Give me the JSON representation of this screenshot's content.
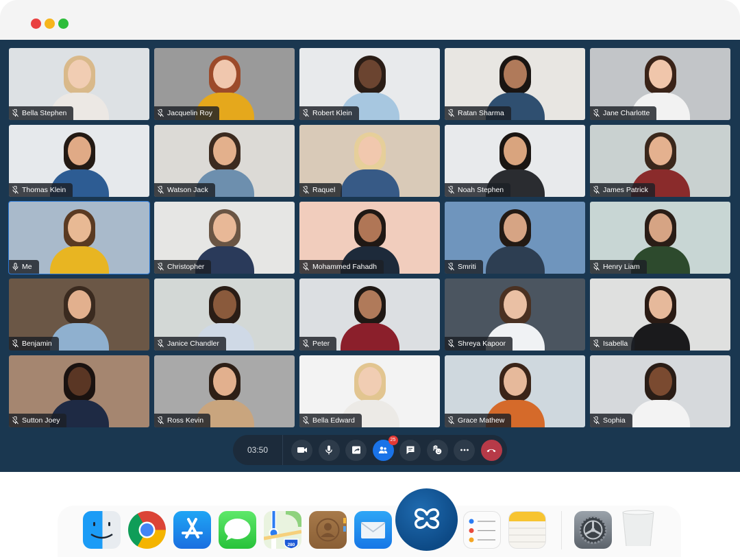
{
  "window": {
    "controls": [
      "close",
      "minimize",
      "maximize"
    ]
  },
  "call": {
    "active_participant": "Me",
    "participants": [
      {
        "name": "Bella Stephen",
        "muted": true,
        "bg": "#dde1e4",
        "skin": "#f1cdb3",
        "hair": "#d9b98a",
        "shirt": "#ece8e4"
      },
      {
        "name": "Jacquelin Roy",
        "muted": true,
        "bg": "#9a9a9a",
        "skin": "#f0c7ae",
        "hair": "#9c4a2a",
        "shirt": "#e5a81c"
      },
      {
        "name": "Robert Klein",
        "muted": true,
        "bg": "#e8eaec",
        "skin": "#6b4430",
        "hair": "#2a1d16",
        "shirt": "#a7c7e0"
      },
      {
        "name": "Ratan Sharma",
        "muted": true,
        "bg": "#e8e6e2",
        "skin": "#b07a5a",
        "hair": "#1a1512",
        "shirt": "#2f4f70"
      },
      {
        "name": "Jane Charlotte",
        "muted": true,
        "bg": "#c2c5c8",
        "skin": "#f0c6ab",
        "hair": "#3a2318",
        "shirt": "#f2f2f2"
      },
      {
        "name": "Thomas Klein",
        "muted": true,
        "bg": "#e6e9ec",
        "skin": "#e0aa86",
        "hair": "#231a14",
        "shirt": "#2d5c93"
      },
      {
        "name": "Watson Jack",
        "muted": true,
        "bg": "#dcdad6",
        "skin": "#e3b08c",
        "hair": "#3b2a1f",
        "shirt": "#6d8fae"
      },
      {
        "name": "Raquel",
        "muted": true,
        "bg": "#d9cab8",
        "skin": "#f1c8ae",
        "hair": "#e6cf9a",
        "shirt": "#375a86"
      },
      {
        "name": "Noah Stephen",
        "muted": true,
        "bg": "#e8eaec",
        "skin": "#d9a47e",
        "hair": "#1a1512",
        "shirt": "#2a2c30"
      },
      {
        "name": "James Patrick",
        "muted": true,
        "bg": "#c9d1d0",
        "skin": "#e4b18f",
        "hair": "#3a271b",
        "shirt": "#8a2b2b"
      },
      {
        "name": "Me",
        "muted": false,
        "bg": "#a9bacb",
        "skin": "#e8b994",
        "hair": "#5a3a22",
        "shirt": "#e8b522"
      },
      {
        "name": "Christopher",
        "muted": true,
        "bg": "#e6e6e4",
        "skin": "#e8b897",
        "hair": "#6a5544",
        "shirt": "#2a3a5a"
      },
      {
        "name": "Mohammed Fahadh",
        "muted": true,
        "bg": "#f1cdbd",
        "skin": "#b07656",
        "hair": "#1f1814",
        "shirt": "#1d2a3a"
      },
      {
        "name": "Smriti",
        "muted": true,
        "bg": "#6f95bd",
        "skin": "#d6a484",
        "hair": "#231a14",
        "shirt": "#2d3e52"
      },
      {
        "name": "Henry Liam",
        "muted": true,
        "bg": "#c8d6d4",
        "skin": "#d6a484",
        "hair": "#2a1d16",
        "shirt": "#2d4a2d"
      },
      {
        "name": "Benjamin",
        "muted": true,
        "bg": "#6b5746",
        "skin": "#e2b08e",
        "hair": "#3a2a1f",
        "shirt": "#8fb0cf"
      },
      {
        "name": "Janice Chandler",
        "muted": true,
        "bg": "#d3d8d6",
        "skin": "#8a5a3c",
        "hair": "#2a1d16",
        "shirt": "#cfd9e6"
      },
      {
        "name": "Peter",
        "muted": true,
        "bg": "#dcdfe2",
        "skin": "#b07a5a",
        "hair": "#1f1814",
        "shirt": "#8b1f2b"
      },
      {
        "name": "Shreya Kapoor",
        "muted": true,
        "bg": "#4b5560",
        "skin": "#eac0a4",
        "hair": "#4a3122",
        "shirt": "#f0f2f4"
      },
      {
        "name": "Isabella",
        "muted": true,
        "bg": "#dfe0df",
        "skin": "#e6b99b",
        "hair": "#2a1b14",
        "shirt": "#1a1a1c"
      },
      {
        "name": "Sutton Joey",
        "muted": true,
        "bg": "#a58670",
        "skin": "#5a3624",
        "hair": "#1a1210",
        "shirt": "#1e2a44"
      },
      {
        "name": "Ross Kevin",
        "muted": true,
        "bg": "#a9a9a9",
        "skin": "#e2b08e",
        "hair": "#2d1f16",
        "shirt": "#c9a57e"
      },
      {
        "name": "Bella Edward",
        "muted": true,
        "bg": "#f3f3f3",
        "skin": "#f1cdb3",
        "hair": "#e2c590",
        "shirt": "#eceae6"
      },
      {
        "name": "Grace Mathew",
        "muted": true,
        "bg": "#cfd8de",
        "skin": "#e6b99b",
        "hair": "#3a2418",
        "shirt": "#d56a2a"
      },
      {
        "name": "Sophia",
        "muted": true,
        "bg": "#d6d9dc",
        "skin": "#7a4a30",
        "hair": "#2a1d16",
        "shirt": "#f3f3f3"
      }
    ]
  },
  "toolbar": {
    "timer": "03:50",
    "buttons": [
      {
        "id": "camera",
        "icon": "video-camera-icon"
      },
      {
        "id": "mic",
        "icon": "microphone-icon"
      },
      {
        "id": "share",
        "icon": "share-screen-icon"
      },
      {
        "id": "participants",
        "icon": "participants-icon",
        "badge": "25",
        "active": true
      },
      {
        "id": "chat",
        "icon": "chat-icon"
      },
      {
        "id": "reactions",
        "icon": "raise-hand-emoji-icon"
      },
      {
        "id": "more",
        "icon": "more-icon"
      },
      {
        "id": "leave",
        "icon": "end-call-icon"
      }
    ]
  },
  "dock": {
    "apps": [
      {
        "name": "Finder",
        "icon": "finder-icon"
      },
      {
        "name": "Chrome",
        "icon": "chrome-icon"
      },
      {
        "name": "App Store",
        "icon": "app-store-icon"
      },
      {
        "name": "Messages",
        "icon": "messages-icon"
      },
      {
        "name": "Maps",
        "icon": "maps-icon",
        "label": "280"
      },
      {
        "name": "Contacts",
        "icon": "contacts-icon"
      },
      {
        "name": "Mail",
        "icon": "mail-icon"
      },
      {
        "name": "Meeting App",
        "icon": "meeting-app-icon",
        "featured": true
      },
      {
        "name": "Reminders",
        "icon": "reminders-icon"
      },
      {
        "name": "Notes",
        "icon": "notes-icon"
      },
      {
        "name": "System Preferences",
        "icon": "system-preferences-icon"
      },
      {
        "name": "Trash",
        "icon": "trash-icon"
      }
    ]
  }
}
